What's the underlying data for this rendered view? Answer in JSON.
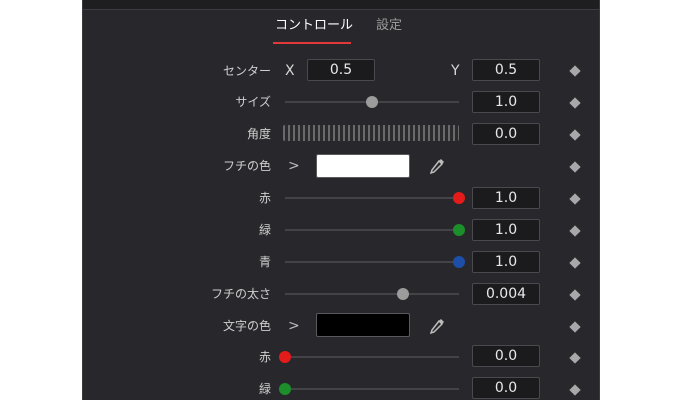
{
  "tabs": [
    {
      "label": "コントロール",
      "active": true
    },
    {
      "label": "設定",
      "active": false
    }
  ],
  "center": {
    "label": "センター",
    "x_label": "X",
    "x_value": "0.5",
    "y_label": "Y",
    "y_value": "0.5"
  },
  "size": {
    "label": "サイズ",
    "value": "1.0",
    "slider_fraction": 0.5
  },
  "angle": {
    "label": "角度",
    "value": "0.0"
  },
  "border_color": {
    "label": "フチの色",
    "swatch_color": "#ffffff",
    "chevron": ">",
    "picker_icon": "eyedropper-icon"
  },
  "border_red": {
    "label": "赤",
    "value": "1.0",
    "slider_fraction": 1.0,
    "thumb_color": "#e31b1b"
  },
  "border_green": {
    "label": "緑",
    "value": "1.0",
    "slider_fraction": 1.0,
    "thumb_color": "#1c8e2a"
  },
  "border_blue": {
    "label": "青",
    "value": "1.0",
    "slider_fraction": 1.0,
    "thumb_color": "#1d4fa8"
  },
  "border_thickness": {
    "label": "フチの太さ",
    "value": "0.004",
    "slider_fraction": 0.68
  },
  "text_color": {
    "label": "文字の色",
    "swatch_color": "#000000",
    "chevron": ">",
    "picker_icon": "eyedropper-icon"
  },
  "text_red": {
    "label": "赤",
    "value": "0.0",
    "slider_fraction": 0.0,
    "thumb_color": "#e31b1b"
  },
  "text_green": {
    "label": "緑",
    "value": "0.0",
    "slider_fraction": 0.0,
    "thumb_color": "#1c8e2a"
  },
  "colors": {
    "panel_bg": "#28282c",
    "accent": "#e23a3a",
    "keyframe": "#a8a8a8"
  }
}
